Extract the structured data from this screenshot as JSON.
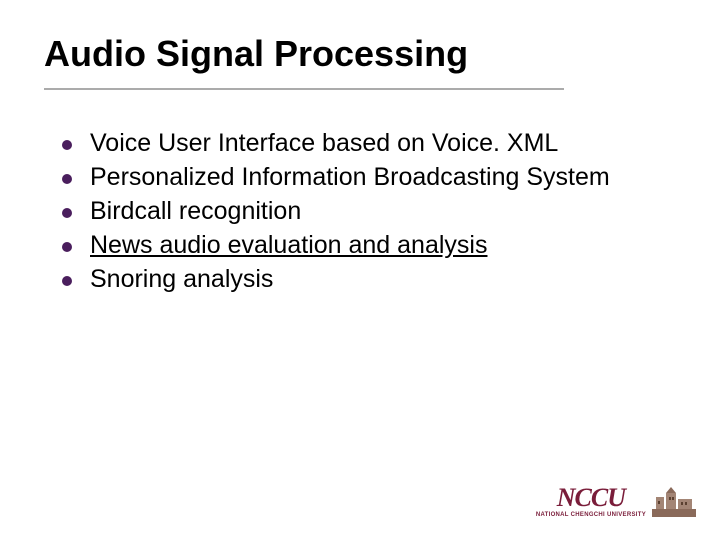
{
  "title": "Audio Signal Processing",
  "bullets": [
    {
      "text": "Voice User Interface based on Voice. XML",
      "link": false
    },
    {
      "text": "Personalized Information Broadcasting System",
      "link": false
    },
    {
      "text": "Birdcall recognition",
      "link": false
    },
    {
      "text": "News audio evaluation and analysis",
      "link": true
    },
    {
      "text": "Snoring analysis",
      "link": false
    }
  ],
  "logo": {
    "acronym": "NCCU",
    "name": "NATIONAL CHENGCHI UNIVERSITY"
  }
}
